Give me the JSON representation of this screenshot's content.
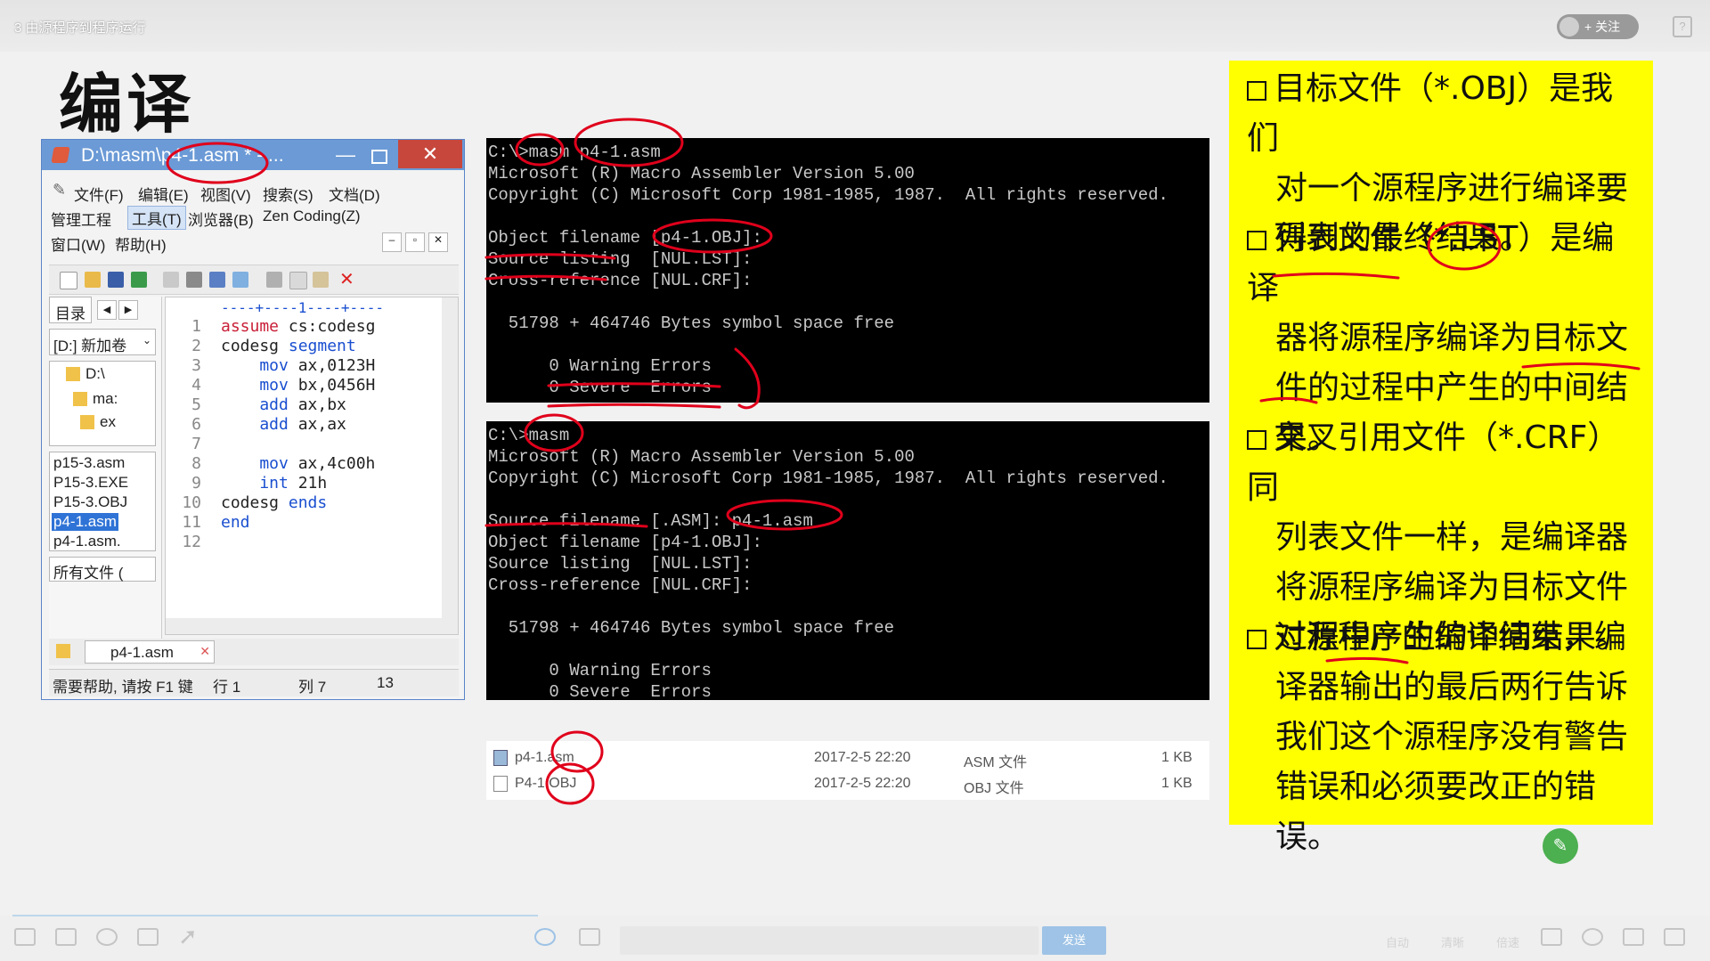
{
  "video_title": "3 由源程序到程序运行",
  "follow_label": "+ 关注",
  "help_label": "?",
  "slide_title": "编译",
  "editor": {
    "title": "D:\\masm\\p4-1.asm * - ...",
    "close_label": "✕",
    "menus_row1": [
      "文件(F)",
      "编辑(E)",
      "视图(V)",
      "搜索(S)",
      "文档(D)"
    ],
    "menus_row2": [
      "管理工程",
      "工具(T)",
      "浏览器(B)",
      "Zen Coding(Z)"
    ],
    "menus_row3": [
      "窗口(W)",
      "帮助(H)"
    ],
    "sidebar": {
      "tab_label": "目录",
      "drive_select": "[D:] 新加卷",
      "tree": [
        "D:\\",
        "ma:",
        "ex"
      ],
      "files": [
        "p15-3.asm",
        "P15-3.EXE",
        "P15-3.OBJ",
        "p4-1.asm",
        "p4-1.asm."
      ],
      "filter_select": "所有文件 (",
      "tab_file": "p4-1.asm"
    },
    "ruler": "----+----1----+----",
    "code_lines": [
      {
        "n": "1",
        "text_a": "assume",
        "text_b": " cs:codesg"
      },
      {
        "n": "2",
        "text_a": "codesg",
        "text_b": " segment"
      },
      {
        "n": "3",
        "text_a": "    mov",
        "text_b": " ax,0123H"
      },
      {
        "n": "4",
        "text_a": "    mov",
        "text_b": " bx,0456H"
      },
      {
        "n": "5",
        "text_a": "    add",
        "text_b": " ax,bx"
      },
      {
        "n": "6",
        "text_a": "    add",
        "text_b": " ax,ax"
      },
      {
        "n": "7",
        "text_a": "",
        "text_b": ""
      },
      {
        "n": "8",
        "text_a": "    mov",
        "text_b": " ax,4c00h"
      },
      {
        "n": "9",
        "text_a": "    int",
        "text_b": " 21h"
      },
      {
        "n": "10",
        "text_a": "codesg",
        "text_b": " ends"
      },
      {
        "n": "11",
        "text_a": "end",
        "text_b": ""
      },
      {
        "n": "12",
        "text_a": "",
        "text_b": ""
      }
    ],
    "status": {
      "help": "需要帮助, 请按 F1 键",
      "row": "行 1",
      "col": "列 7",
      "num": "13"
    }
  },
  "console1": [
    "C:\\>masm p4-1.asm",
    "Microsoft (R) Macro Assembler Version 5.00",
    "Copyright (C) Microsoft Corp 1981-1985, 1987.  All rights reserved.",
    "",
    "Object filename [p4-1.OBJ]:",
    "Source listing  [NUL.LST]:",
    "Cross-reference [NUL.CRF]:",
    "",
    "  51798 + 464746 Bytes symbol space free",
    "",
    "      0 Warning Errors",
    "      0 Severe  Errors"
  ],
  "console2": [
    "C:\\>masm",
    "Microsoft (R) Macro Assembler Version 5.00",
    "Copyright (C) Microsoft Corp 1981-1985, 1987.  All rights reserved.",
    "",
    "Source filename [.ASM]: p4-1.asm",
    "Object filename [p4-1.OBJ]:",
    "Source listing  [NUL.LST]:",
    "Cross-reference [NUL.CRF]:",
    "",
    "  51798 + 464746 Bytes symbol space free",
    "",
    "      0 Warning Errors",
    "      0 Severe  Errors"
  ],
  "files": [
    {
      "name": "p4-1.asm",
      "date": "2017-2-5 22:20",
      "type": "ASM 文件",
      "size": "1 KB"
    },
    {
      "name": "P4-1.OBJ",
      "date": "2017-2-5 22:20",
      "type": "OBJ 文件",
      "size": "1 KB"
    }
  ],
  "notes": [
    {
      "lines": [
        "目标文件（*.OBJ）是我们",
        "对一个源程序进行编译要",
        "得到的最终结果。"
      ]
    },
    {
      "lines": [
        "列表文件（*.LST）是编译",
        "器将源程序编译为目标文",
        "件的过程中产生的中间结",
        "果。"
      ]
    },
    {
      "lines": [
        "交叉引用文件（*.CRF）同",
        "列表文件一样，是编译器",
        "将源程序编译为目标文件",
        "过程中产生的中间结果。"
      ]
    },
    {
      "lines": [
        "对源程序的编译结束，编",
        "译器输出的最后两行告诉",
        "我们这个源程序没有警告",
        "错误和必须要改正的错误。"
      ]
    }
  ],
  "bottom": {
    "send_label": "发送",
    "labels": [
      "自动",
      "清晰",
      "倍速"
    ]
  },
  "colors": {
    "notes_bg": "#ffff00",
    "ink": "#e0001b",
    "console_bg": "#000000",
    "titlebar": "#6b9ad6"
  }
}
